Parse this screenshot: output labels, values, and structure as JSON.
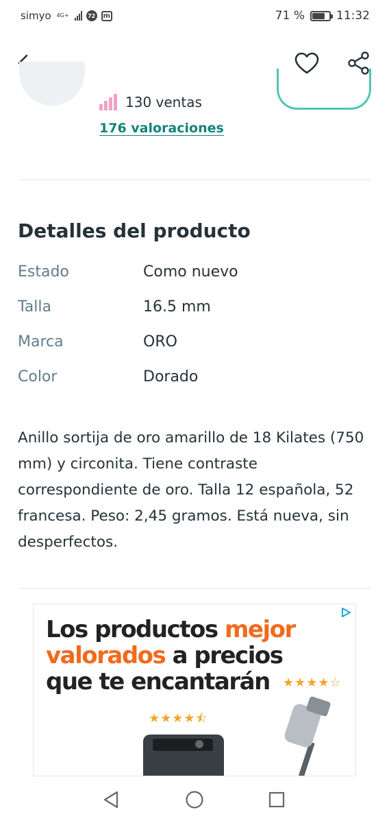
{
  "status_bar": {
    "carrier": "simyo",
    "network": "4G+",
    "badge_text": "72",
    "app_icon": "m",
    "battery_percent": "71 %",
    "battery_level": 0.71,
    "time": "11:32"
  },
  "nav": {
    "back_icon": "arrow-left-icon",
    "favorite_icon": "heart-icon",
    "share_icon": "share-icon"
  },
  "seller": {
    "sales": "130 ventas",
    "ratings": "176 valoraciones",
    "accent_color": "#13837a"
  },
  "details": {
    "title": "Detalles del producto",
    "rows": [
      {
        "label": "Estado",
        "value": "Como nuevo"
      },
      {
        "label": "Talla",
        "value": "16.5 mm"
      },
      {
        "label": "Marca",
        "value": "ORO"
      },
      {
        "label": "Color",
        "value": "Dorado"
      }
    ]
  },
  "description": "Anillo sortija de oro amarillo de 18 Kilates (750 mm) y circonita. Tiene contraste correspondiente de oro. Talla 12 española, 52 francesa. Peso: 2,45 gramos. Está nueva, sin desperfectos.",
  "ad": {
    "headline_1": "Los productos ",
    "headline_1_highlight": "mejor",
    "headline_2_highlight": "valorados",
    "headline_2": " a precios",
    "headline_3": "que te encantarán",
    "stars_right": "★★★★☆",
    "stars_left": "★★★★⯪",
    "highlight_color": "#f06b1d"
  }
}
